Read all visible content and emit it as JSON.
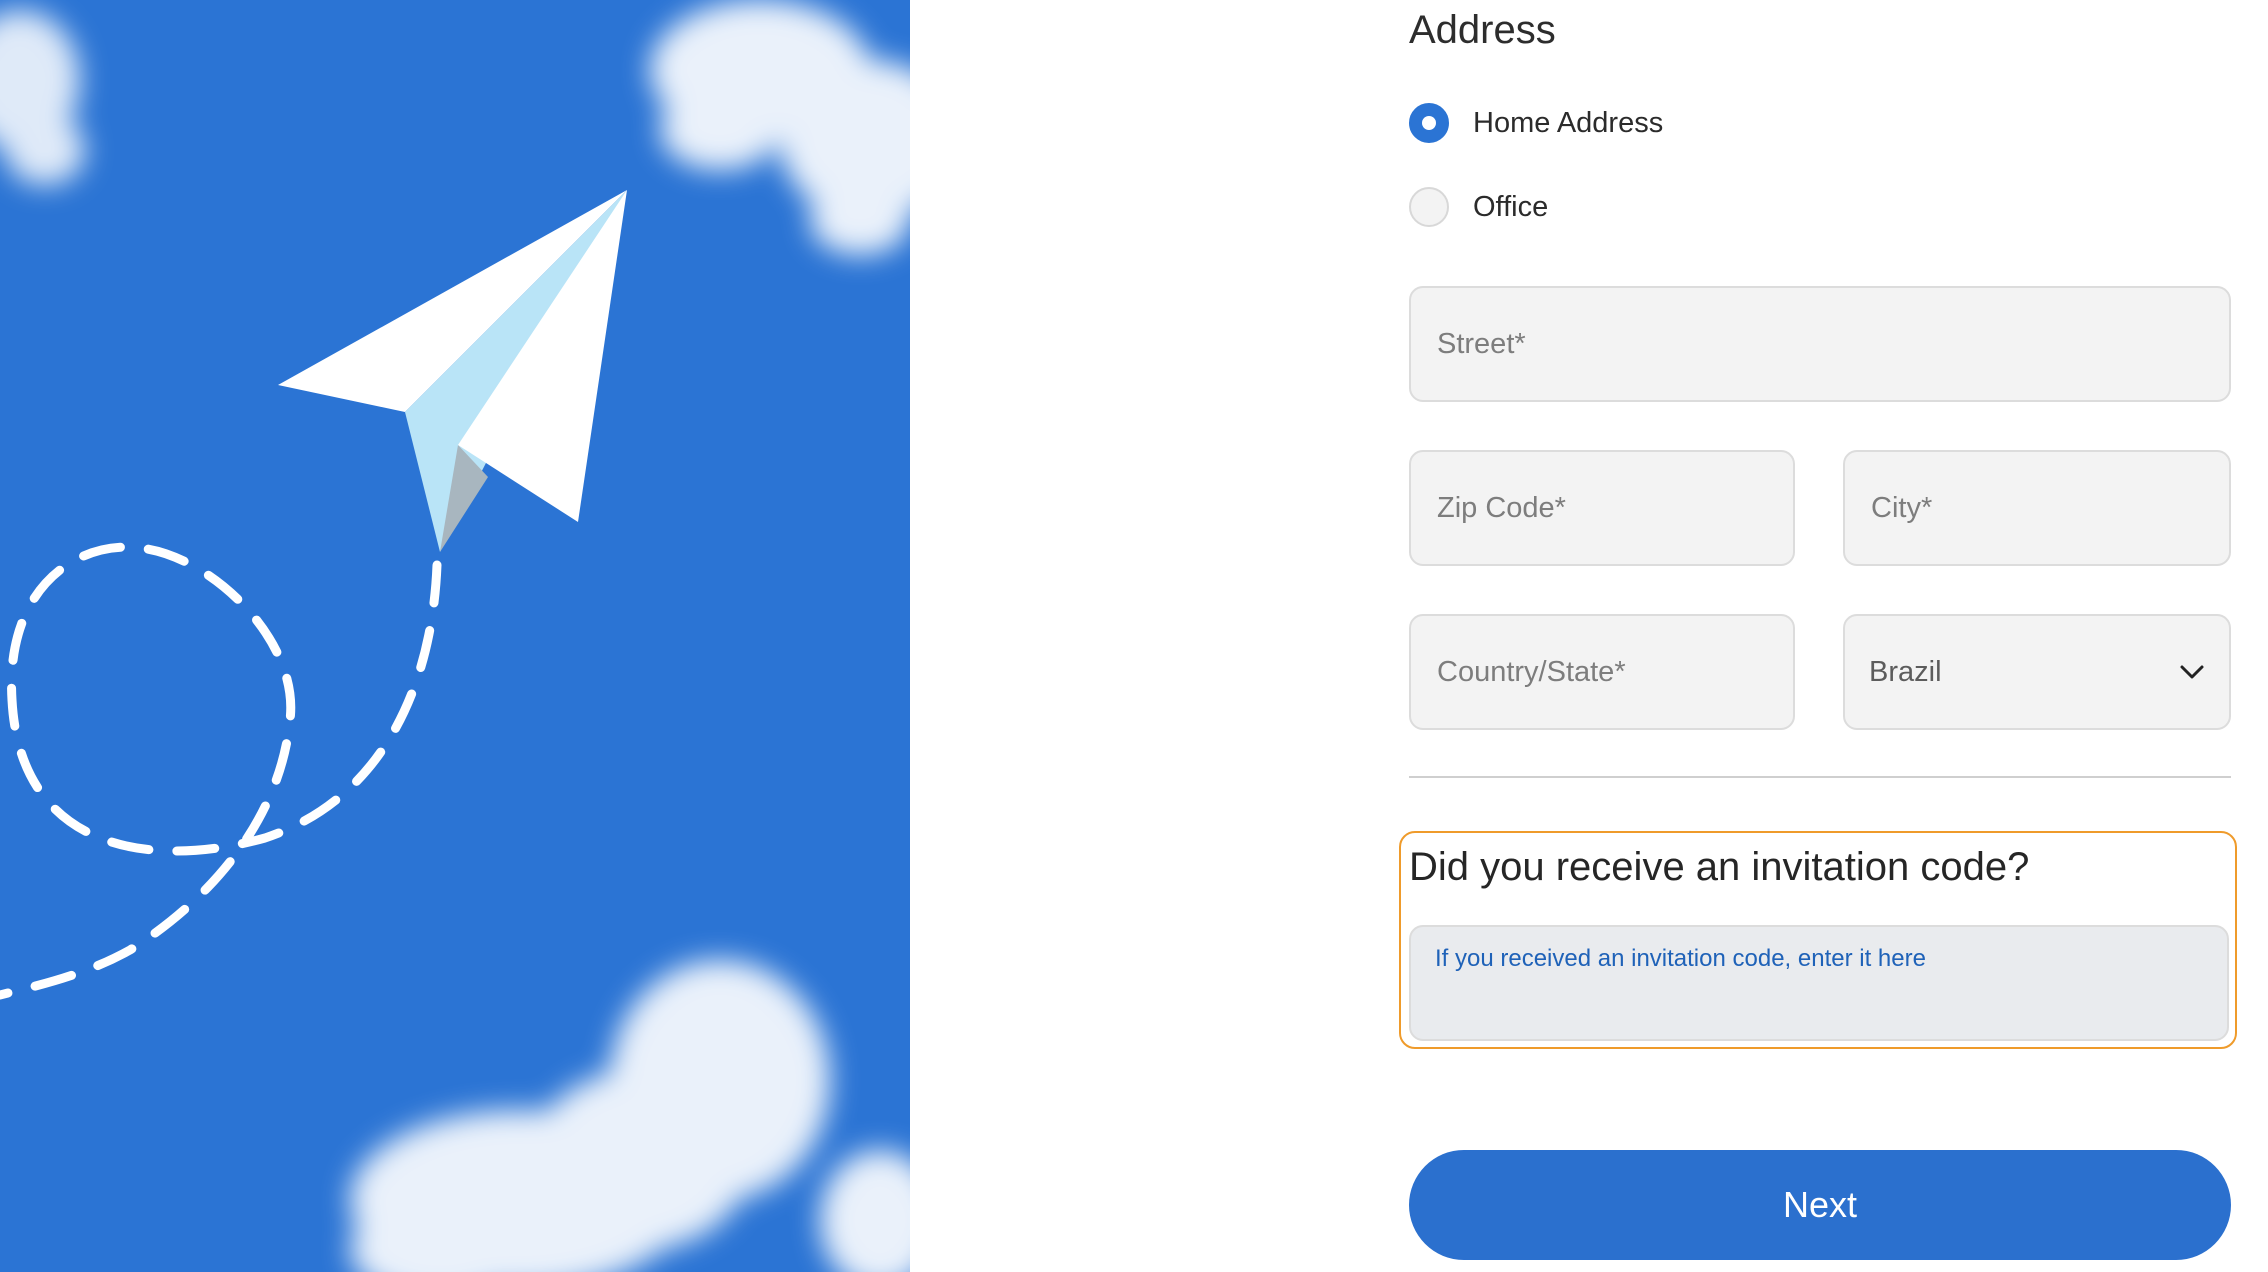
{
  "colors": {
    "accent": "#2b74d4",
    "highlight_border": "#ef9b2b",
    "invite_text": "#1f62b8"
  },
  "hero": {
    "illustration": "paper-plane-in-sky"
  },
  "address": {
    "title": "Address",
    "types": [
      {
        "label": "Home Address",
        "selected": true
      },
      {
        "label": "Office",
        "selected": false
      }
    ],
    "street": {
      "placeholder": "Street*",
      "value": ""
    },
    "zip": {
      "placeholder": "Zip Code*",
      "value": ""
    },
    "city": {
      "placeholder": "City*",
      "value": ""
    },
    "state": {
      "placeholder": "Country/State*",
      "value": ""
    },
    "country": {
      "selected": "Brazil",
      "icon": "chevron-down-icon"
    }
  },
  "invitation": {
    "title": "Did you receive an invitation code?",
    "placeholder": "If you received an invitation code, enter it here",
    "value": ""
  },
  "actions": {
    "next_label": "Next"
  }
}
